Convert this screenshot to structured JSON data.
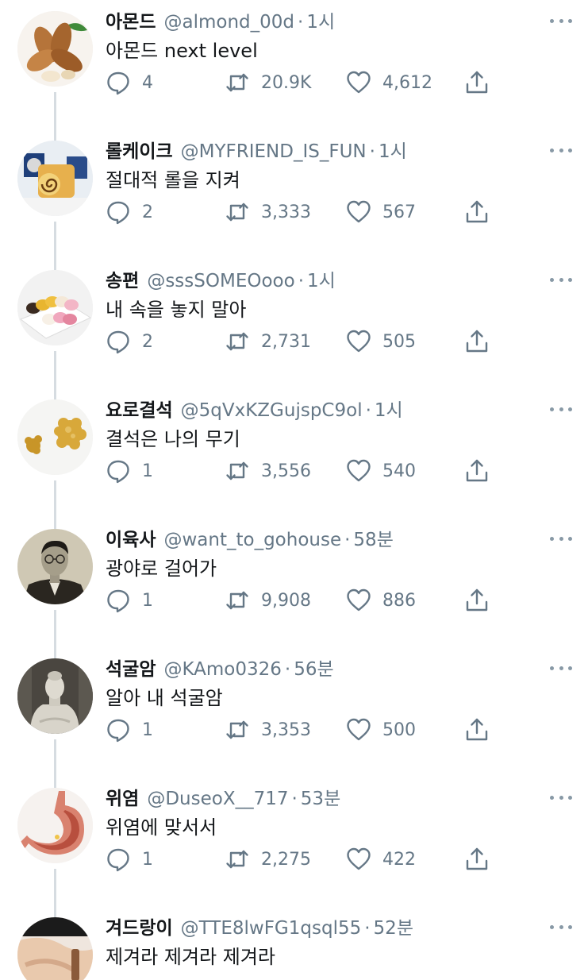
{
  "colors": {
    "text": "#14171a",
    "muted": "#657786",
    "icon": "#657786",
    "thread": "#d6dce1"
  },
  "tweets": [
    {
      "name": "아몬드",
      "handle": "@almond_00d",
      "time": "1시",
      "text": "아몬드 next level",
      "replies": "4",
      "retweets": "20.9K",
      "likes": "4,612",
      "avatar_icon": "almond-avatar"
    },
    {
      "name": "롤케이크",
      "handle": "@MYFRIEND_IS_FUN",
      "time": "1시",
      "text": "절대적 롤을 지켜",
      "replies": "2",
      "retweets": "3,333",
      "likes": "567",
      "avatar_icon": "roll-cake-avatar"
    },
    {
      "name": "송편",
      "handle": "@sssSOMEOooo",
      "time": "1시",
      "text": "내 속을 놓지 말아",
      "replies": "2",
      "retweets": "2,731",
      "likes": "505",
      "avatar_icon": "songpyeon-avatar"
    },
    {
      "name": "요로결석",
      "handle": "@5qVxKZGujspC9ol",
      "time": "1시",
      "text": "결석은 나의 무기",
      "replies": "1",
      "retweets": "3,556",
      "likes": "540",
      "avatar_icon": "kidney-stone-avatar"
    },
    {
      "name": "이육사",
      "handle": "@want_to_gohouse",
      "time": "58분",
      "text": "광야로 걸어가",
      "replies": "1",
      "retweets": "9,908",
      "likes": "886",
      "avatar_icon": "portrait-avatar"
    },
    {
      "name": "석굴암",
      "handle": "@KAmo0326",
      "time": "56분",
      "text": "알아 내 석굴암",
      "replies": "1",
      "retweets": "3,353",
      "likes": "500",
      "avatar_icon": "buddha-statue-avatar"
    },
    {
      "name": "위염",
      "handle": "@DuseoX__717",
      "time": "53분",
      "text": "위염에 맞서서",
      "replies": "1",
      "retweets": "2,275",
      "likes": "422",
      "avatar_icon": "stomach-avatar"
    },
    {
      "name": "겨드랑이",
      "handle": "@TTE8lwFG1qsql55",
      "time": "52분",
      "text": "제겨라 제겨라 제겨라",
      "avatar_icon": "armpit-avatar"
    }
  ]
}
